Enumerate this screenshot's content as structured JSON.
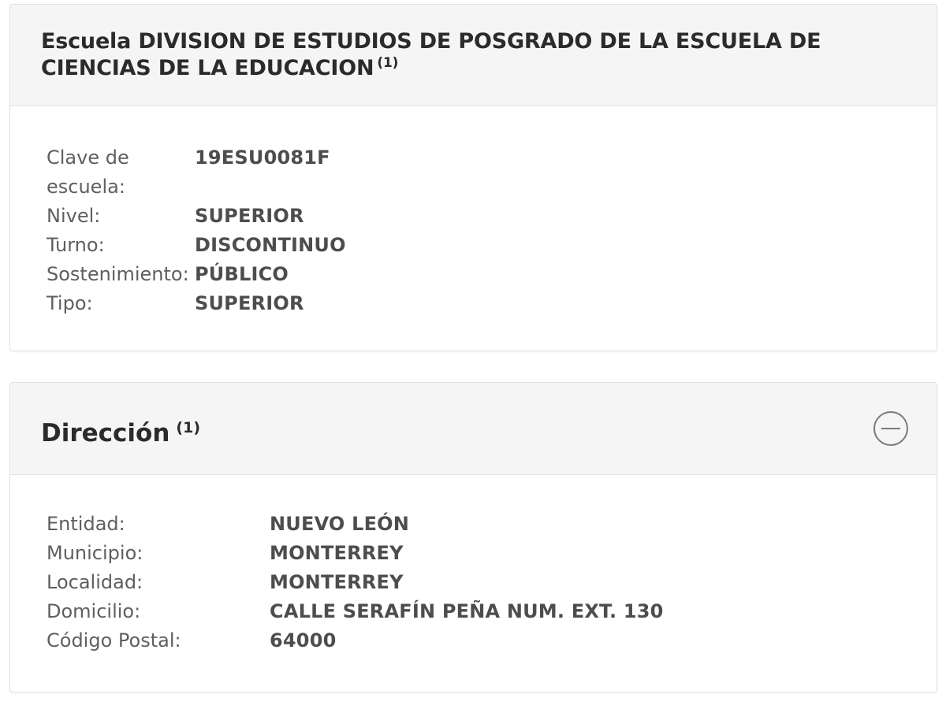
{
  "school": {
    "title": "Escuela DIVISION DE ESTUDIOS DE POSGRADO DE LA ESCUELA DE CIENCIAS DE LA EDUCACION",
    "footnote": "(1)",
    "fields": [
      {
        "label": "Clave de escuela:",
        "value": "19ESU0081F"
      },
      {
        "label": "Nivel:",
        "value": "SUPERIOR"
      },
      {
        "label": "Turno:",
        "value": "DISCONTINUO"
      },
      {
        "label": "Sostenimiento:",
        "value": "PÚBLICO"
      },
      {
        "label": "Tipo:",
        "value": "SUPERIOR"
      }
    ]
  },
  "address": {
    "title": "Dirección",
    "footnote": "(1)",
    "collapse_icon": "minus-circle-icon",
    "fields": [
      {
        "label": "Entidad:",
        "value": "NUEVO LEÓN"
      },
      {
        "label": "Municipio:",
        "value": "MONTERREY"
      },
      {
        "label": "Localidad:",
        "value": "MONTERREY"
      },
      {
        "label": "Domicilio:",
        "value": "CALLE SERAFÍN PEÑA NUM. EXT. 130"
      },
      {
        "label": "Código Postal:",
        "value": "64000"
      }
    ]
  },
  "colors": {
    "header_bg": "#f5f5f5",
    "border": "#e2e2e2",
    "title_text": "#2b2b2b",
    "label_text": "#5f5f5f",
    "value_text": "#4d4d4d"
  }
}
